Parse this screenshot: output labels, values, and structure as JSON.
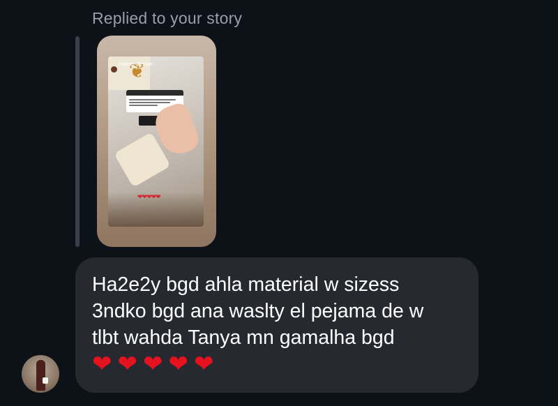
{
  "reply": {
    "caption": "Replied to your story"
  },
  "story": {
    "username": "hadeer_lifestyle"
  },
  "message": {
    "lines": [
      "Ha2e2y bgd ahla material w sizess",
      "3ndko bgd ana waslty el pejama de w",
      "tlbt wahda Tanya mn gamalha bgd"
    ],
    "hearts": [
      "❤",
      "❤",
      "❤",
      "❤",
      "❤"
    ],
    "heart_color": "#e5121f"
  },
  "theme": {
    "background": "#0d1118",
    "bubble": "#262a30",
    "caption_color": "#9aa0a8"
  }
}
